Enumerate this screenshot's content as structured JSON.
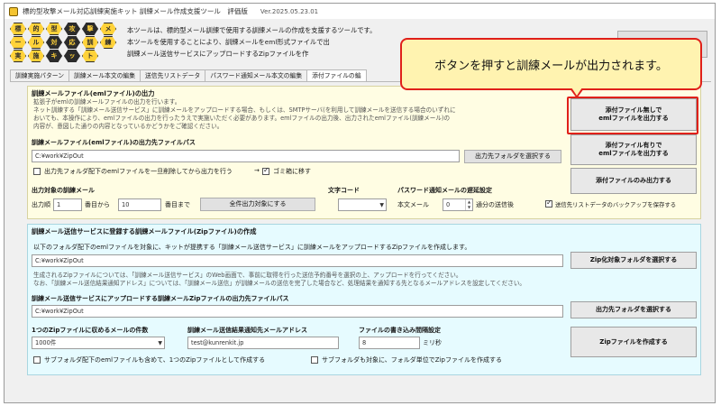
{
  "window": {
    "title": "標的型攻撃メール対応訓練実施キット 訓練メール作成支援ツール　評価版",
    "version": "Ver.2025.05.23.01"
  },
  "header": {
    "logo_chars": [
      "標",
      "的",
      "型",
      "攻",
      "撃",
      "メ",
      "ー",
      "ル",
      "対",
      "応",
      "訓",
      "練",
      "実",
      "施",
      "キ",
      "ッ",
      "ト"
    ],
    "desc1": "本ツールは、標的型メール訓練で使用する訓練メールの作成を支援するツールです。",
    "desc2": "本ツールを使用することにより、訓練メールをeml形式ファイルで出",
    "desc3": "訓練メール送信サービスにアップロードするZipファイルを作"
  },
  "tabs": [
    "訓練実施パターン",
    "訓練メール本文の編集",
    "送信先リストデータ",
    "パスワード通知メール本文の編集",
    "添付ファイルの編"
  ],
  "panel1": {
    "title": "訓練メールファイル(emlファイル)の出力",
    "note1": "拡張子がemlの訓練メールファイルの出力を行います。",
    "note2": "ネット訓練する「訓練メール送信サービス」に訓練メールをアップロードする場合、もしくは、SMTPサーバ(を利用して訓練メールを送信する場合のいずれに",
    "note3": "おいても、本操作により、emlファイルの出力を行ったうえで実施いただく必要があります。emlファイルの出力後、出力されたemlファイル(訓練メール)の",
    "note4": "内容が、意図した通りの内容となっているかどうかをご確認ください。",
    "path_label": "訓練メールファイル(emlファイル)の出力先ファイルパス",
    "path_value": "C:¥work¥ZipOut",
    "select_folder_btn": "出力先フォルダを選択する",
    "delete_check_label": "出力先フォルダ配下のemlファイルを一旦削除してから出力を行う",
    "arrow": "→",
    "trash_label": "ゴミ箱に移す",
    "target_label": "出力対象の訓練メール",
    "range_label": "出力順",
    "range_from": "1",
    "from_suffix": "番目から",
    "range_to": "10",
    "to_suffix": "番目まで",
    "all_target_btn": "全件出力対象にする",
    "charset_label": "文字コード",
    "pw_delay_label": "パスワード通知メールの遅延設定",
    "body_mail_label": "本文メール",
    "delay_value": "0",
    "delay_suffix": "通分の送信後",
    "backup_label": "送信先リストデータのバックアップを保存する",
    "btn_no_attach": "添付ファイル無しで\nemlファイルを出力する",
    "btn_with_attach": "添付ファイル有りで\nemlファイルを出力する",
    "btn_attach_only": "添付ファイルのみ出力する"
  },
  "panel2": {
    "title": "訓練メール送信サービスに登録する訓練メールファイル(Zipファイル)の作成",
    "subtitle": "以下のフォルダ配下のemlファイルを対象に、キットが提携する「訓練メール送信サービス」に訓練メールをアップロードするZipファイルを作成します。",
    "folder_value": "C:¥work¥ZipOut",
    "zip_target_btn": "Zip化対象フォルダを選択する",
    "note1": "生成されるZipファイルについては、「訓練メール送信サービス」のWeb画面で、事前に取得を行った送信予約番号を選択の上、アップロードを行ってください。",
    "note2": "なお、「訓練メール送信結果通知アドレス」については、「訓練メール送信」が訓練メールの送信を完了した場合など、処理結果を通知する先となるメールアドレスを設定してください。",
    "zip_path_label": "訓練メール送信サービスにアップロードする訓練メールZipファイルの出力先ファイルパス",
    "zip_path_value": "C:¥work¥ZipOut",
    "select_folder_btn": "出力先フォルダを選択する",
    "count_label": "1つのZipファイルに収めるメールの件数",
    "count_value": "1000件",
    "notify_label": "訓練メール送信結果通知先メールアドレス",
    "notify_value": "test@kunrenkit.jp",
    "interval_label": "ファイルの書き込み間隔設定",
    "interval_value": "8",
    "interval_unit": "ミリ秒",
    "create_zip_btn": "Zipファイルを作成する",
    "sub_check1": "サブフォルダ配下のemlファイルも含めて、1つのZipファイルとして作成する",
    "sub_check2": "サブフォルダも対象に、フォルダ単位でZipファイルを作成する"
  },
  "callout": {
    "text": "ボタンを押すと訓練メールが出力されます。"
  },
  "colors": {
    "panel1_bg": "#fffde3",
    "panel2_bg": "#e6fbff",
    "highlight": "#e0201a",
    "callout_bg": "#fff3b0"
  }
}
